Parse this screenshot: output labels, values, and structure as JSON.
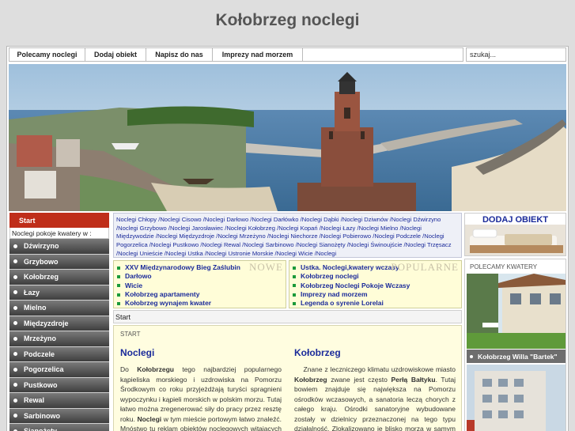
{
  "site": {
    "title": "Kołobrzeg noclegi"
  },
  "topnav": {
    "items": [
      {
        "label": "Polecamy noclegi",
        "width": 96
      },
      {
        "label": "Dodaj obiekt",
        "width": 77
      },
      {
        "label": "Napisz do nas",
        "width": 84
      },
      {
        "label": "Imprezy nad morzem",
        "width": 114
      }
    ]
  },
  "search": {
    "placeholder": "szukaj..."
  },
  "sidebar": {
    "start": "Start",
    "note": "Noclegi pokoje kwatery w :",
    "items": [
      "Dźwirzyno",
      "Grzybowo",
      "Kołobrzeg",
      "Łazy",
      "Mielno",
      "Międzyzdroje",
      "Mrzeżyno",
      "Podczele",
      "Pogorzelica",
      "Pustkowo",
      "Rewal",
      "Sarbinowo",
      "Sianożęty"
    ]
  },
  "links": [
    "Noclegi Chłopy",
    "Noclegi Cisowo",
    "Noclegi Darłowo",
    "Noclegi Darłówko",
    "Noclegi Dąbki",
    "Noclegi Dziwnów",
    "Noclegi Dźwirzyno",
    "Noclegi Grzybowo",
    "Noclegi Jarosławiec",
    "Noclegi Kołobrzeg",
    "Noclegi Kopań",
    "Noclegi Łazy",
    "Noclegi Mielno",
    "Noclegi Międzywodzie",
    "Noclegi Międzyzdroje",
    "Noclegi Mrzeżyno",
    "Noclegi Niechorze",
    "Noclegi Pobierowo",
    "Noclegi Podczele",
    "Noclegi Pogorzelica",
    "Noclegi Pustkowo",
    "Noclegi Rewal",
    "Noclegi Sarbinowo",
    "Noclegi Sianożęty",
    "Noclegi Świnoujście",
    "Noclegi Trzęsacz",
    "Noclegi Unieście",
    "Noclegi Ustka",
    "Noclegi Ustronie Morskie",
    "Noclegi Wicie",
    "Noclegi"
  ],
  "news_new": {
    "watermark": "NOWE",
    "items": [
      "XXV Międzynarodowy Bieg Zaślubin",
      "Darłowo",
      "Wicie",
      "Kołobrzeg apartamenty",
      "Kołobrzeg wynajem kwater"
    ]
  },
  "news_popular": {
    "watermark": "POPULARNE",
    "items": [
      "Ustka. Noclegi,kwatery wczasy",
      "Kołobrzeg noclegi",
      "Kołobrzeg Noclegi Pokoje Wczasy",
      "Imprezy nad morzem",
      "Legenda o syrenie Lorelai"
    ]
  },
  "breadcrumb": "Start",
  "content": {
    "label": "START",
    "left": {
      "title": "Noclegi",
      "pre": "Do ",
      "strong1": "Kołobrzegu",
      "mid": " tego najbardziej popularnego kąpieliska morskiego i uzdrowiska na Pomorzu Środkowym co roku przyjeżdżają turyści spragnieni wypoczynku i kąpieli morskich w polskim morzu. Tutaj łatwo można zregenerować siły do pracy przez resztę roku. ",
      "strong2": "Noclegi",
      "post": " w tym mieście portowym łatwo znaleźć. Mnóstwo tu reklam obiektów noclegowych witających turystów"
    },
    "right": {
      "title": "Kołobrzeg",
      "pre": "Znane z leczniczego klimatu uzdrowiskowe miasto ",
      "strong1": "Kołobrzeg",
      "mid": " zwane jest często ",
      "strong2": "Perłą Bałtyku",
      "post": ". Tutaj bowiem znajduje się największa na Pomorzu ośrodków wczasowych, a sanatoria leczą chorych z całego kraju. Ośrodki sanatoryjne wybudowane zostały w dzielnicy przeznaczonej na tego typu działalność. Zlokalizowano je blisko morza w samym pasie nadmorskim, gdzie"
    }
  },
  "dodaj": {
    "title": "DODAJ OBIEKT"
  },
  "polecamy": {
    "title": "POLECAMY KWATERY",
    "caption": "Kołobrzeg Willa \"Bartek\""
  },
  "colors": {
    "accent_red": "#bf2e1a",
    "link_blue": "#1a2a9a",
    "news_bg": "#fffdd8",
    "sidebar_dark": "#3e3e3e"
  }
}
